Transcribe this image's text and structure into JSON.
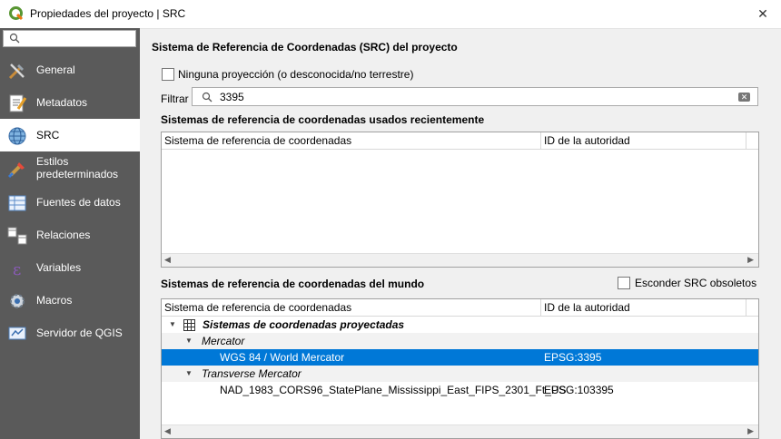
{
  "window": {
    "title": "Propiedades del proyecto | SRC",
    "close_glyph": "✕"
  },
  "sidebar": {
    "search_placeholder": "",
    "items": [
      {
        "label": "General",
        "icon": "tools-icon"
      },
      {
        "label": "Metadatos",
        "icon": "metadata-icon"
      },
      {
        "label": "SRC",
        "icon": "globe-icon"
      },
      {
        "label": "Estilos predeterminados",
        "label_lines": [
          "Estilos",
          "predeterminados"
        ],
        "icon": "paintbrush-icon"
      },
      {
        "label": "Fuentes de datos",
        "icon": "datasource-icon"
      },
      {
        "label": "Relaciones",
        "icon": "relations-icon"
      },
      {
        "label": "Variables",
        "icon": "variables-icon"
      },
      {
        "label": "Macros",
        "icon": "macros-icon"
      },
      {
        "label": "Servidor de QGIS",
        "icon": "server-icon"
      }
    ],
    "active_index": 2
  },
  "main": {
    "heading": "Sistema de Referencia de Coordenadas (SRC) del proyecto",
    "no_projection_label": "Ninguna proyección (o desconocida/no terrestre)",
    "filter_label": "Filtrar",
    "filter_value": "3395",
    "recent": {
      "title": "Sistemas de referencia de coordenadas usados recientemente",
      "columns": [
        "Sistema de referencia de coordenadas",
        "ID de la autoridad"
      ]
    },
    "world": {
      "title": "Sistemas de referencia de coordenadas del mundo",
      "hide_deprecated_label": "Esconder SRC obsoletos",
      "columns": [
        "Sistema de referencia de coordenadas",
        "ID de la autoridad"
      ],
      "rows": {
        "group": "Sistemas de coordenadas proyectadas",
        "sub1": "Mercator",
        "item1_name": "WGS 84 / World Mercator",
        "item1_id": "EPSG:3395",
        "sub2": "Transverse Mercator",
        "item2_name": "NAD_1983_CORS96_StatePlane_Mississippi_East_FIPS_2301_Ft_US",
        "item2_id": "EPSG:103395"
      }
    }
  },
  "colors": {
    "sidebar_bg": "#5a5a5a",
    "selection": "#0078d7",
    "qgis_green": "#589632",
    "qgis_yellow": "#ee7913"
  }
}
